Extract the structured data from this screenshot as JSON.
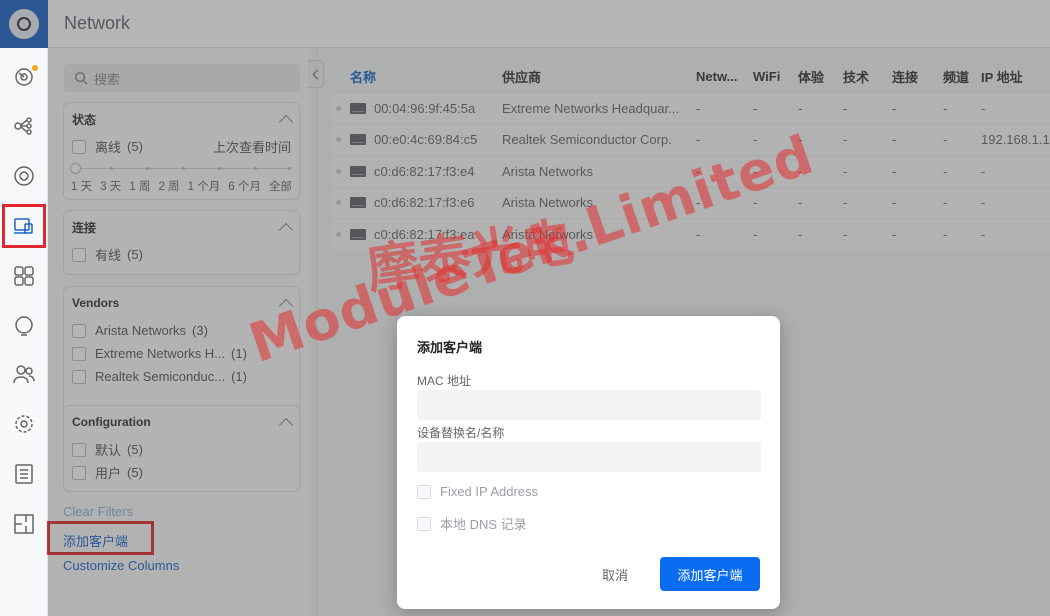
{
  "app": {
    "title": "Network"
  },
  "rail": [
    {
      "name": "dashboard-icon",
      "badge": true
    },
    {
      "name": "topology-icon"
    },
    {
      "name": "radar-icon"
    },
    {
      "name": "clients-icon",
      "active": true
    },
    {
      "name": "apps-icon"
    },
    {
      "name": "insights-icon"
    },
    {
      "name": "users-icon"
    },
    {
      "name": "settings-icon"
    },
    {
      "name": "logs-icon"
    },
    {
      "name": "floorplan-icon"
    }
  ],
  "filters": {
    "search_placeholder": "搜索",
    "status": {
      "title": "状态",
      "offline_label": "离线",
      "offline_count": "(5)",
      "last_seen_label": "上次查看时间",
      "ticks": [
        "1 天",
        "3 天",
        "1 周",
        "2 周",
        "1 个月",
        "6 个月",
        "全部"
      ]
    },
    "connection": {
      "title": "连接",
      "wired_label": "有线",
      "wired_count": "(5)"
    },
    "vendors": {
      "title": "Vendors",
      "items": [
        {
          "label": "Arista Networks",
          "count": "(3)"
        },
        {
          "label": "Extreme Networks H...",
          "count": "(1)"
        },
        {
          "label": "Realtek Semiconduc...",
          "count": "(1)"
        }
      ]
    },
    "configuration": {
      "title": "Configuration",
      "items": [
        {
          "label": "默认",
          "count": "(5)"
        },
        {
          "label": "用户",
          "count": "(5)"
        }
      ]
    },
    "clear_filters": "Clear Filters",
    "add_client": "添加客户端",
    "customize_columns": "Customize Columns"
  },
  "table": {
    "headers": {
      "name": "名称",
      "vendor": "供应商",
      "network": "Netw...",
      "wifi": "WiFi",
      "experience": "体验",
      "technology": "技术",
      "connection": "连接",
      "channel": "频道",
      "ip": "IP 地址"
    },
    "rows": [
      {
        "name": "00:04:96:9f:45:5a",
        "vendor": "Extreme Networks Headquar...",
        "network": "-",
        "wifi": "-",
        "experience": "-",
        "technology": "-",
        "connection": "-",
        "channel": "-",
        "ip": "-"
      },
      {
        "name": "00:e0:4c:69:84:c5",
        "vendor": "Realtek Semiconductor Corp.",
        "network": "-",
        "wifi": "-",
        "experience": "-",
        "technology": "-",
        "connection": "-",
        "channel": "-",
        "ip": "192.168.1.1"
      },
      {
        "name": "c0:d6:82:17:f3:e4",
        "vendor": "Arista Networks",
        "network": "-",
        "wifi": "-",
        "experience": "-",
        "technology": "-",
        "connection": "-",
        "channel": "-",
        "ip": "-"
      },
      {
        "name": "c0:d6:82:17:f3:e6",
        "vendor": "Arista Networks",
        "network": "-",
        "wifi": "-",
        "experience": "-",
        "technology": "-",
        "connection": "-",
        "channel": "-",
        "ip": "-"
      },
      {
        "name": "c0:d6:82:17:f3:ea",
        "vendor": "Arista Networks",
        "network": "-",
        "wifi": "-",
        "experience": "-",
        "technology": "-",
        "connection": "-",
        "channel": "-",
        "ip": "-"
      }
    ]
  },
  "modal": {
    "title": "添加客户端",
    "mac_label": "MAC 地址",
    "mac_value": "",
    "alias_label": "设备替换名/名称",
    "alias_value": "",
    "fixed_ip_label": "Fixed IP Address",
    "local_dns_label": "本地 DNS 记录",
    "cancel_label": "取消",
    "submit_label": "添加客户端"
  },
  "watermark": {
    "line1": "摩泰光电",
    "line2": "ModuleTek.Limited"
  },
  "colors": {
    "accent": "#0a6cf0",
    "highlight": "#e0282f",
    "watermark": "#e12d2d"
  }
}
